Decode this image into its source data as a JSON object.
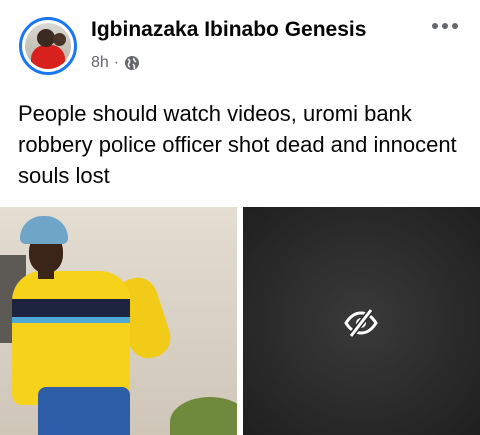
{
  "post": {
    "author": "Igbinazaka Ibinabo Genesis",
    "time": "8h",
    "separator": "·",
    "privacy_icon": "globe-icon",
    "more_icon": "more-options-icon",
    "text": "People should watch videos, uromi bank robbery police officer shot dead and innocent souls lost"
  },
  "media": {
    "photo_icon": "photo",
    "hidden_icon": "eye-off-icon"
  },
  "colors": {
    "avatar_ring": "#1877f2",
    "text": "#050505",
    "meta": "#65676b",
    "sensitive_bg": "#2b2b2b"
  }
}
